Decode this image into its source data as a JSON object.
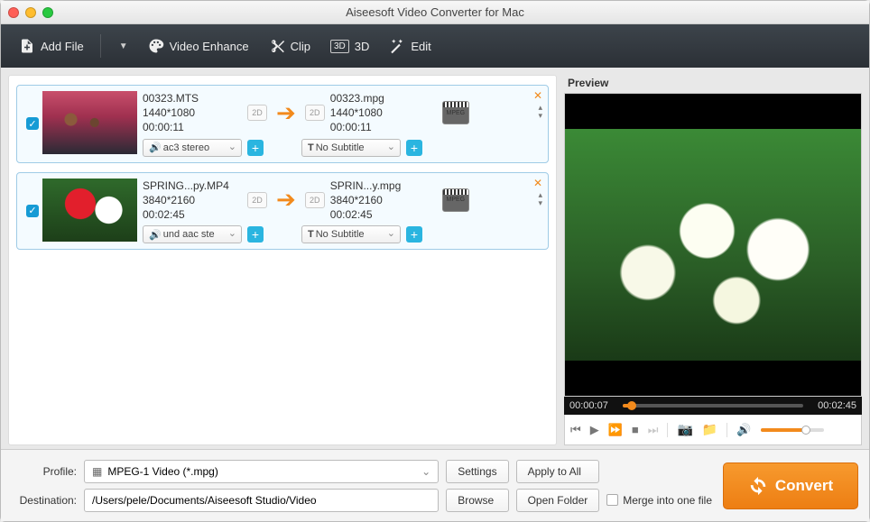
{
  "window": {
    "title": "Aiseesoft Video Converter for Mac"
  },
  "toolbar": {
    "add_file": "Add File",
    "video_enhance": "Video Enhance",
    "clip": "Clip",
    "three_d": "3D",
    "edit": "Edit"
  },
  "items": [
    {
      "src_name": "00323.MTS",
      "src_res": "1440*1080",
      "src_dur": "00:00:11",
      "out_name": "00323.mpg",
      "out_res": "1440*1080",
      "out_dur": "00:00:11",
      "audio": "ac3 stereo",
      "subtitle": "No Subtitle",
      "badge_src": "2D",
      "badge_out": "2D"
    },
    {
      "src_name": "SPRING...py.MP4",
      "src_res": "3840*2160",
      "src_dur": "00:02:45",
      "out_name": "SPRIN...y.mpg",
      "out_res": "3840*2160",
      "out_dur": "00:02:45",
      "audio": "und aac ste",
      "subtitle": "No Subtitle",
      "badge_src": "2D",
      "badge_out": "2D"
    }
  ],
  "preview": {
    "label": "Preview",
    "time_cur": "00:00:07",
    "time_total": "00:02:45"
  },
  "bottom": {
    "profile_label": "Profile:",
    "profile_value": "MPEG-1 Video (*.mpg)",
    "settings": "Settings",
    "apply_all": "Apply to All",
    "dest_label": "Destination:",
    "dest_value": "/Users/pele/Documents/Aiseesoft Studio/Video",
    "browse": "Browse",
    "open_folder": "Open Folder",
    "merge": "Merge into one file",
    "convert": "Convert"
  }
}
